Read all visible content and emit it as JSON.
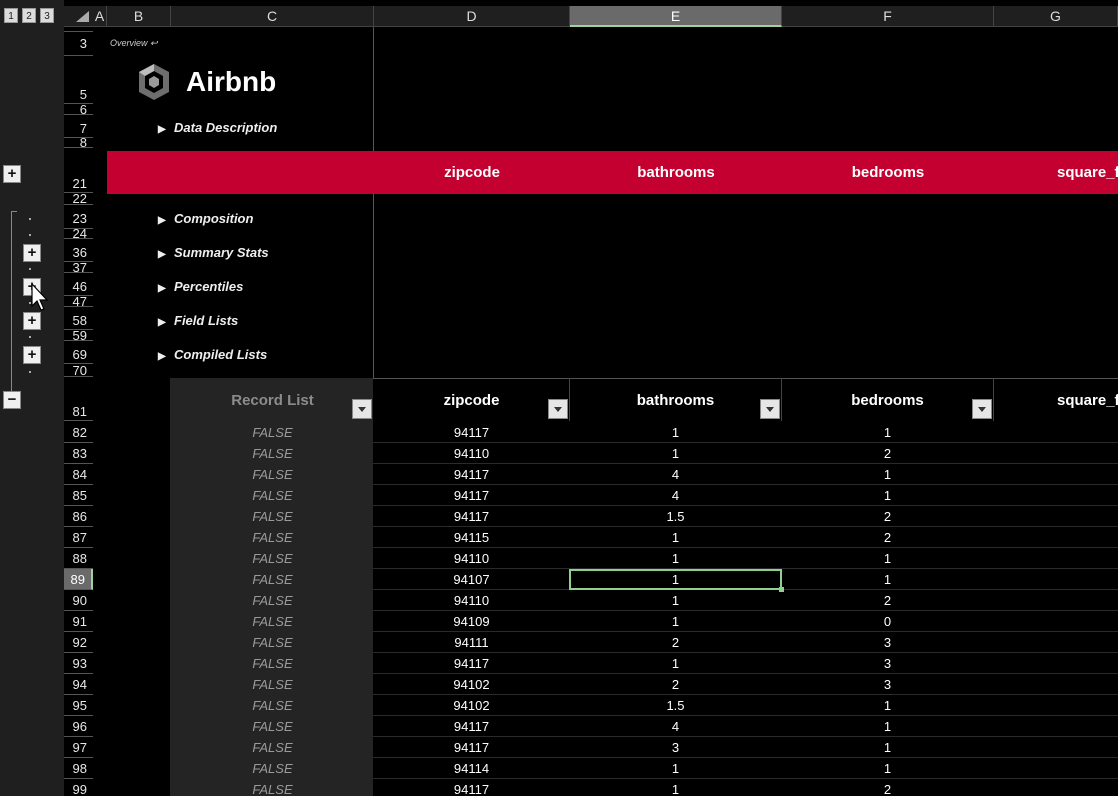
{
  "outline": {
    "levels": [
      "1",
      "2",
      "3"
    ]
  },
  "columns": [
    {
      "label": "A"
    },
    {
      "label": "B"
    },
    {
      "label": "C"
    },
    {
      "label": "D"
    },
    {
      "label": "E"
    },
    {
      "label": "F"
    },
    {
      "label": "G"
    }
  ],
  "top_rows": [
    "3",
    "5",
    "6",
    "7",
    "8",
    "21",
    "22",
    "23",
    "24",
    "36",
    "37",
    "46",
    "47",
    "58",
    "59",
    "69",
    "70",
    "81"
  ],
  "title": {
    "overview": "Overview ↩",
    "brand": "Airbnb"
  },
  "sections": [
    "Data Description",
    "Composition",
    "Summary Stats",
    "Percentiles",
    "Field Lists",
    "Compiled Lists"
  ],
  "header_band": [
    "zipcode",
    "bathrooms",
    "bedrooms",
    "square_f"
  ],
  "table": {
    "headers": [
      "Record List",
      "zipcode",
      "bathrooms",
      "bedrooms",
      "square_f"
    ],
    "rows": [
      {
        "row": "82",
        "rec": "FALSE",
        "zip": "94117",
        "bath": "1",
        "bed": "1"
      },
      {
        "row": "83",
        "rec": "FALSE",
        "zip": "94110",
        "bath": "1",
        "bed": "2"
      },
      {
        "row": "84",
        "rec": "FALSE",
        "zip": "94117",
        "bath": "4",
        "bed": "1"
      },
      {
        "row": "85",
        "rec": "FALSE",
        "zip": "94117",
        "bath": "4",
        "bed": "1"
      },
      {
        "row": "86",
        "rec": "FALSE",
        "zip": "94117",
        "bath": "1.5",
        "bed": "2"
      },
      {
        "row": "87",
        "rec": "FALSE",
        "zip": "94115",
        "bath": "1",
        "bed": "2"
      },
      {
        "row": "88",
        "rec": "FALSE",
        "zip": "94110",
        "bath": "1",
        "bed": "1"
      },
      {
        "row": "89",
        "rec": "FALSE",
        "zip": "94107",
        "bath": "1",
        "bed": "1"
      },
      {
        "row": "90",
        "rec": "FALSE",
        "zip": "94110",
        "bath": "1",
        "bed": "2"
      },
      {
        "row": "91",
        "rec": "FALSE",
        "zip": "94109",
        "bath": "1",
        "bed": "0"
      },
      {
        "row": "92",
        "rec": "FALSE",
        "zip": "94111",
        "bath": "2",
        "bed": "3"
      },
      {
        "row": "93",
        "rec": "FALSE",
        "zip": "94117",
        "bath": "1",
        "bed": "3"
      },
      {
        "row": "94",
        "rec": "FALSE",
        "zip": "94102",
        "bath": "2",
        "bed": "3"
      },
      {
        "row": "95",
        "rec": "FALSE",
        "zip": "94102",
        "bath": "1.5",
        "bed": "1"
      },
      {
        "row": "96",
        "rec": "FALSE",
        "zip": "94117",
        "bath": "4",
        "bed": "1"
      },
      {
        "row": "97",
        "rec": "FALSE",
        "zip": "94117",
        "bath": "3",
        "bed": "1"
      },
      {
        "row": "98",
        "rec": "FALSE",
        "zip": "94114",
        "bath": "1",
        "bed": "1"
      },
      {
        "row": "99",
        "rec": "FALSE",
        "zip": "94117",
        "bath": "1",
        "bed": "2"
      }
    ],
    "active_row": "89"
  },
  "colors": {
    "accent_red": "#c3002f",
    "active_border": "#8fd08f"
  }
}
